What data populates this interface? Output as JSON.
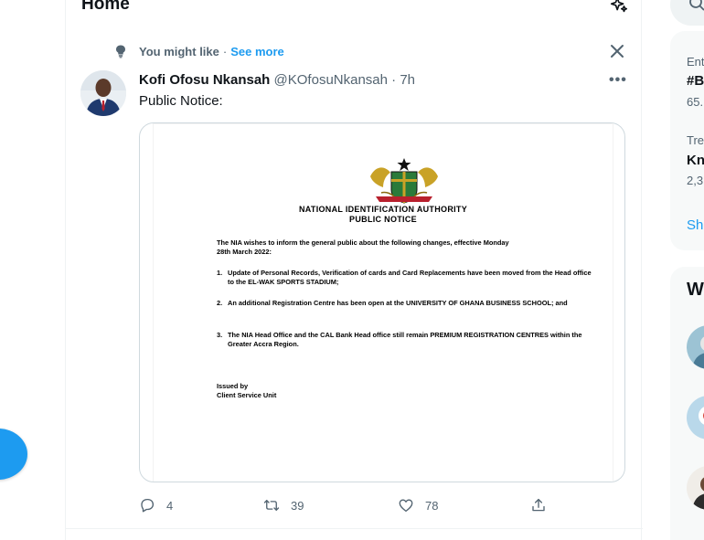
{
  "header": {
    "title": "Home",
    "sparkle_icon": "sparkle-icon"
  },
  "suggestion": {
    "label": "You might like",
    "separator": "·",
    "see_more": "See more"
  },
  "tweet": {
    "author_name": "Kofi Ofosu Nkansah",
    "handle": "@KOfosuNkansah",
    "separator": "·",
    "time": "7h",
    "text": "Public Notice:",
    "media": {
      "org": "NATIONAL IDENTIFICATION AUTHORITY",
      "heading": "PUBLIC NOTICE",
      "intro_line1": "The NIA wishes to inform the general public about the following changes, effective Monday",
      "intro_line2": "28th March 2022:",
      "items": [
        {
          "num": "1.",
          "text": "Update of Personal Records, Verification of cards and Card Replacements have been moved from the Head office to the EL-WAK SPORTS STADIUM;"
        },
        {
          "num": "2.",
          "text": "An additional Registration Centre has been open at the UNIVERSITY OF GHANA BUSINESS SCHOOL; and"
        },
        {
          "num": "3.",
          "text": "The NIA Head Office and the CAL Bank Head office still remain PREMIUM REGISTRATION CENTRES within the Greater Accra Region."
        }
      ],
      "issued_by": "Issued by",
      "issuer": "Client Service Unit"
    },
    "actions": {
      "replies": "4",
      "retweets": "39",
      "likes": "78"
    }
  },
  "sidebar": {
    "trends": [
      {
        "meta": "Ent",
        "tag": "#B",
        "count": "65."
      },
      {
        "meta": "Tre",
        "tag": "Kn",
        "count": "2,3"
      }
    ],
    "show_more": "Sh",
    "who_to_follow_title": "W"
  },
  "colors": {
    "accent": "#1d9bf0",
    "text": "#0f1419",
    "muted": "#536471",
    "border": "#eff3f4"
  }
}
